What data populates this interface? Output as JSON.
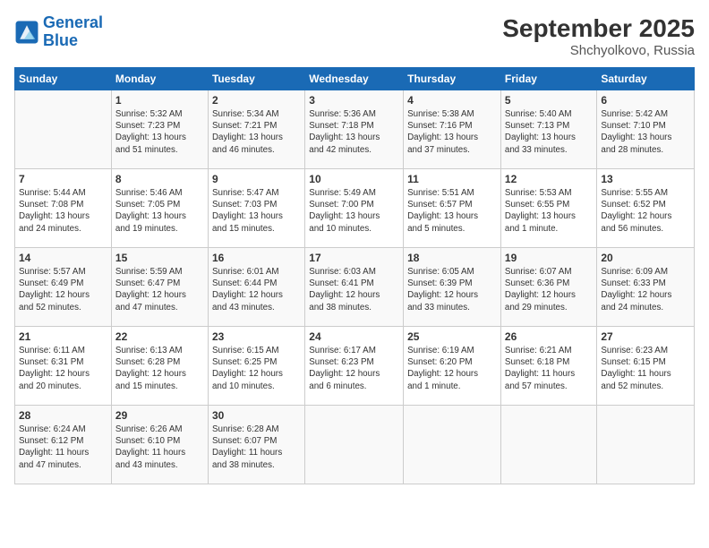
{
  "logo": {
    "line1": "General",
    "line2": "Blue"
  },
  "title": "September 2025",
  "subtitle": "Shchyolkovo, Russia",
  "weekdays": [
    "Sunday",
    "Monday",
    "Tuesday",
    "Wednesday",
    "Thursday",
    "Friday",
    "Saturday"
  ],
  "weeks": [
    [
      {
        "day": "",
        "info": ""
      },
      {
        "day": "1",
        "info": "Sunrise: 5:32 AM\nSunset: 7:23 PM\nDaylight: 13 hours\nand 51 minutes."
      },
      {
        "day": "2",
        "info": "Sunrise: 5:34 AM\nSunset: 7:21 PM\nDaylight: 13 hours\nand 46 minutes."
      },
      {
        "day": "3",
        "info": "Sunrise: 5:36 AM\nSunset: 7:18 PM\nDaylight: 13 hours\nand 42 minutes."
      },
      {
        "day": "4",
        "info": "Sunrise: 5:38 AM\nSunset: 7:16 PM\nDaylight: 13 hours\nand 37 minutes."
      },
      {
        "day": "5",
        "info": "Sunrise: 5:40 AM\nSunset: 7:13 PM\nDaylight: 13 hours\nand 33 minutes."
      },
      {
        "day": "6",
        "info": "Sunrise: 5:42 AM\nSunset: 7:10 PM\nDaylight: 13 hours\nand 28 minutes."
      }
    ],
    [
      {
        "day": "7",
        "info": "Sunrise: 5:44 AM\nSunset: 7:08 PM\nDaylight: 13 hours\nand 24 minutes."
      },
      {
        "day": "8",
        "info": "Sunrise: 5:46 AM\nSunset: 7:05 PM\nDaylight: 13 hours\nand 19 minutes."
      },
      {
        "day": "9",
        "info": "Sunrise: 5:47 AM\nSunset: 7:03 PM\nDaylight: 13 hours\nand 15 minutes."
      },
      {
        "day": "10",
        "info": "Sunrise: 5:49 AM\nSunset: 7:00 PM\nDaylight: 13 hours\nand 10 minutes."
      },
      {
        "day": "11",
        "info": "Sunrise: 5:51 AM\nSunset: 6:57 PM\nDaylight: 13 hours\nand 5 minutes."
      },
      {
        "day": "12",
        "info": "Sunrise: 5:53 AM\nSunset: 6:55 PM\nDaylight: 13 hours\nand 1 minute."
      },
      {
        "day": "13",
        "info": "Sunrise: 5:55 AM\nSunset: 6:52 PM\nDaylight: 12 hours\nand 56 minutes."
      }
    ],
    [
      {
        "day": "14",
        "info": "Sunrise: 5:57 AM\nSunset: 6:49 PM\nDaylight: 12 hours\nand 52 minutes."
      },
      {
        "day": "15",
        "info": "Sunrise: 5:59 AM\nSunset: 6:47 PM\nDaylight: 12 hours\nand 47 minutes."
      },
      {
        "day": "16",
        "info": "Sunrise: 6:01 AM\nSunset: 6:44 PM\nDaylight: 12 hours\nand 43 minutes."
      },
      {
        "day": "17",
        "info": "Sunrise: 6:03 AM\nSunset: 6:41 PM\nDaylight: 12 hours\nand 38 minutes."
      },
      {
        "day": "18",
        "info": "Sunrise: 6:05 AM\nSunset: 6:39 PM\nDaylight: 12 hours\nand 33 minutes."
      },
      {
        "day": "19",
        "info": "Sunrise: 6:07 AM\nSunset: 6:36 PM\nDaylight: 12 hours\nand 29 minutes."
      },
      {
        "day": "20",
        "info": "Sunrise: 6:09 AM\nSunset: 6:33 PM\nDaylight: 12 hours\nand 24 minutes."
      }
    ],
    [
      {
        "day": "21",
        "info": "Sunrise: 6:11 AM\nSunset: 6:31 PM\nDaylight: 12 hours\nand 20 minutes."
      },
      {
        "day": "22",
        "info": "Sunrise: 6:13 AM\nSunset: 6:28 PM\nDaylight: 12 hours\nand 15 minutes."
      },
      {
        "day": "23",
        "info": "Sunrise: 6:15 AM\nSunset: 6:25 PM\nDaylight: 12 hours\nand 10 minutes."
      },
      {
        "day": "24",
        "info": "Sunrise: 6:17 AM\nSunset: 6:23 PM\nDaylight: 12 hours\nand 6 minutes."
      },
      {
        "day": "25",
        "info": "Sunrise: 6:19 AM\nSunset: 6:20 PM\nDaylight: 12 hours\nand 1 minute."
      },
      {
        "day": "26",
        "info": "Sunrise: 6:21 AM\nSunset: 6:18 PM\nDaylight: 11 hours\nand 57 minutes."
      },
      {
        "day": "27",
        "info": "Sunrise: 6:23 AM\nSunset: 6:15 PM\nDaylight: 11 hours\nand 52 minutes."
      }
    ],
    [
      {
        "day": "28",
        "info": "Sunrise: 6:24 AM\nSunset: 6:12 PM\nDaylight: 11 hours\nand 47 minutes."
      },
      {
        "day": "29",
        "info": "Sunrise: 6:26 AM\nSunset: 6:10 PM\nDaylight: 11 hours\nand 43 minutes."
      },
      {
        "day": "30",
        "info": "Sunrise: 6:28 AM\nSunset: 6:07 PM\nDaylight: 11 hours\nand 38 minutes."
      },
      {
        "day": "",
        "info": ""
      },
      {
        "day": "",
        "info": ""
      },
      {
        "day": "",
        "info": ""
      },
      {
        "day": "",
        "info": ""
      }
    ]
  ]
}
